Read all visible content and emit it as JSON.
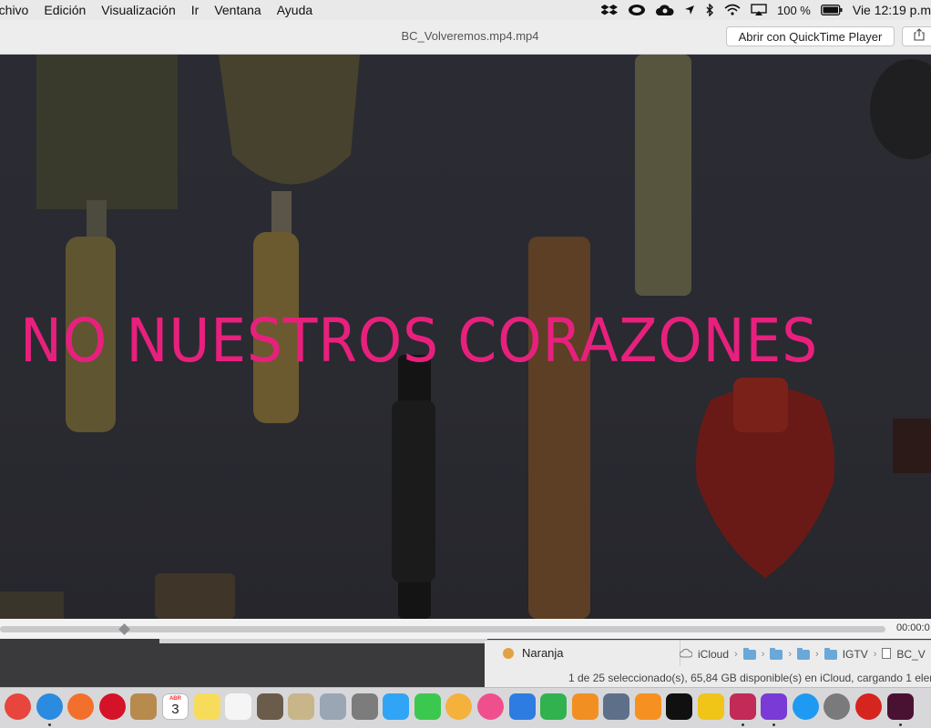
{
  "menubar": {
    "menus": [
      "rchivo",
      "Edición",
      "Visualización",
      "Ir",
      "Ventana",
      "Ayuda"
    ],
    "battery": "100 %",
    "clock": "Vie 12:19 p.m"
  },
  "window": {
    "title": "BC_Volveremos.mp4.mp4",
    "open_button": "Abrir con QuickTime Player"
  },
  "video": {
    "caption": "NO NUESTROS CORAZONES",
    "caption_color": "#e8207d"
  },
  "player": {
    "time": "00:00:0",
    "progress": 0.14
  },
  "finder": {
    "tag_label": "Naranja",
    "tag_color": "#e0a243",
    "path": [
      "iCloud",
      "IGTV",
      "BC_V"
    ],
    "status": "1 de 25 seleccionado(s), 65,84 GB disponible(s) en iCloud, cargando 1 elem"
  },
  "dock": {
    "calendar_day": "3",
    "calendar_month": "ABR",
    "apps": [
      {
        "name": "chrome",
        "color": "#e8453c",
        "running": false
      },
      {
        "name": "safari",
        "color": "#2a8be0",
        "running": true
      },
      {
        "name": "firefox",
        "color": "#f2702b",
        "running": false
      },
      {
        "name": "opera",
        "color": "#d41228",
        "running": false
      },
      {
        "name": "contacts",
        "color": "#b78a4e",
        "running": false
      },
      {
        "name": "calendar",
        "color": "#ffffff",
        "running": false
      },
      {
        "name": "notes",
        "color": "#f7dc5c",
        "running": false
      },
      {
        "name": "reminders",
        "color": "#f5f5f5",
        "running": false
      },
      {
        "name": "calculator",
        "color": "#6b5b4b",
        "running": false
      },
      {
        "name": "preview",
        "color": "#c8b68a",
        "running": false
      },
      {
        "name": "photos-edit",
        "color": "#9aa6b4",
        "running": false
      },
      {
        "name": "screenshot",
        "color": "#7c7c7c",
        "running": false
      },
      {
        "name": "messages",
        "color": "#31a5f5",
        "running": false
      },
      {
        "name": "facetime",
        "color": "#3cc84f",
        "running": false
      },
      {
        "name": "photos",
        "color": "#f4b13b",
        "running": false
      },
      {
        "name": "itunes",
        "color": "#f04f8e",
        "running": false
      },
      {
        "name": "keynote",
        "color": "#2d7ce1",
        "running": false
      },
      {
        "name": "numbers",
        "color": "#31b24f",
        "running": false
      },
      {
        "name": "pages",
        "color": "#f28f22",
        "running": false
      },
      {
        "name": "image-capture",
        "color": "#5e7089",
        "running": false
      },
      {
        "name": "ibooks",
        "color": "#f69121",
        "running": false
      },
      {
        "name": "kindle",
        "color": "#101010",
        "running": false
      },
      {
        "name": "cyberduck",
        "color": "#f0c419",
        "running": false
      },
      {
        "name": "affinity",
        "color": "#c22a57",
        "running": true
      },
      {
        "name": "imovie",
        "color": "#7a3ad6",
        "running": true
      },
      {
        "name": "app-store",
        "color": "#1e9af2",
        "running": false
      },
      {
        "name": "system-preferences",
        "color": "#7a7a7d",
        "running": false
      },
      {
        "name": "creative-cloud",
        "color": "#d6241e",
        "running": false
      },
      {
        "name": "indesign",
        "color": "#4a1232",
        "running": true
      }
    ]
  }
}
